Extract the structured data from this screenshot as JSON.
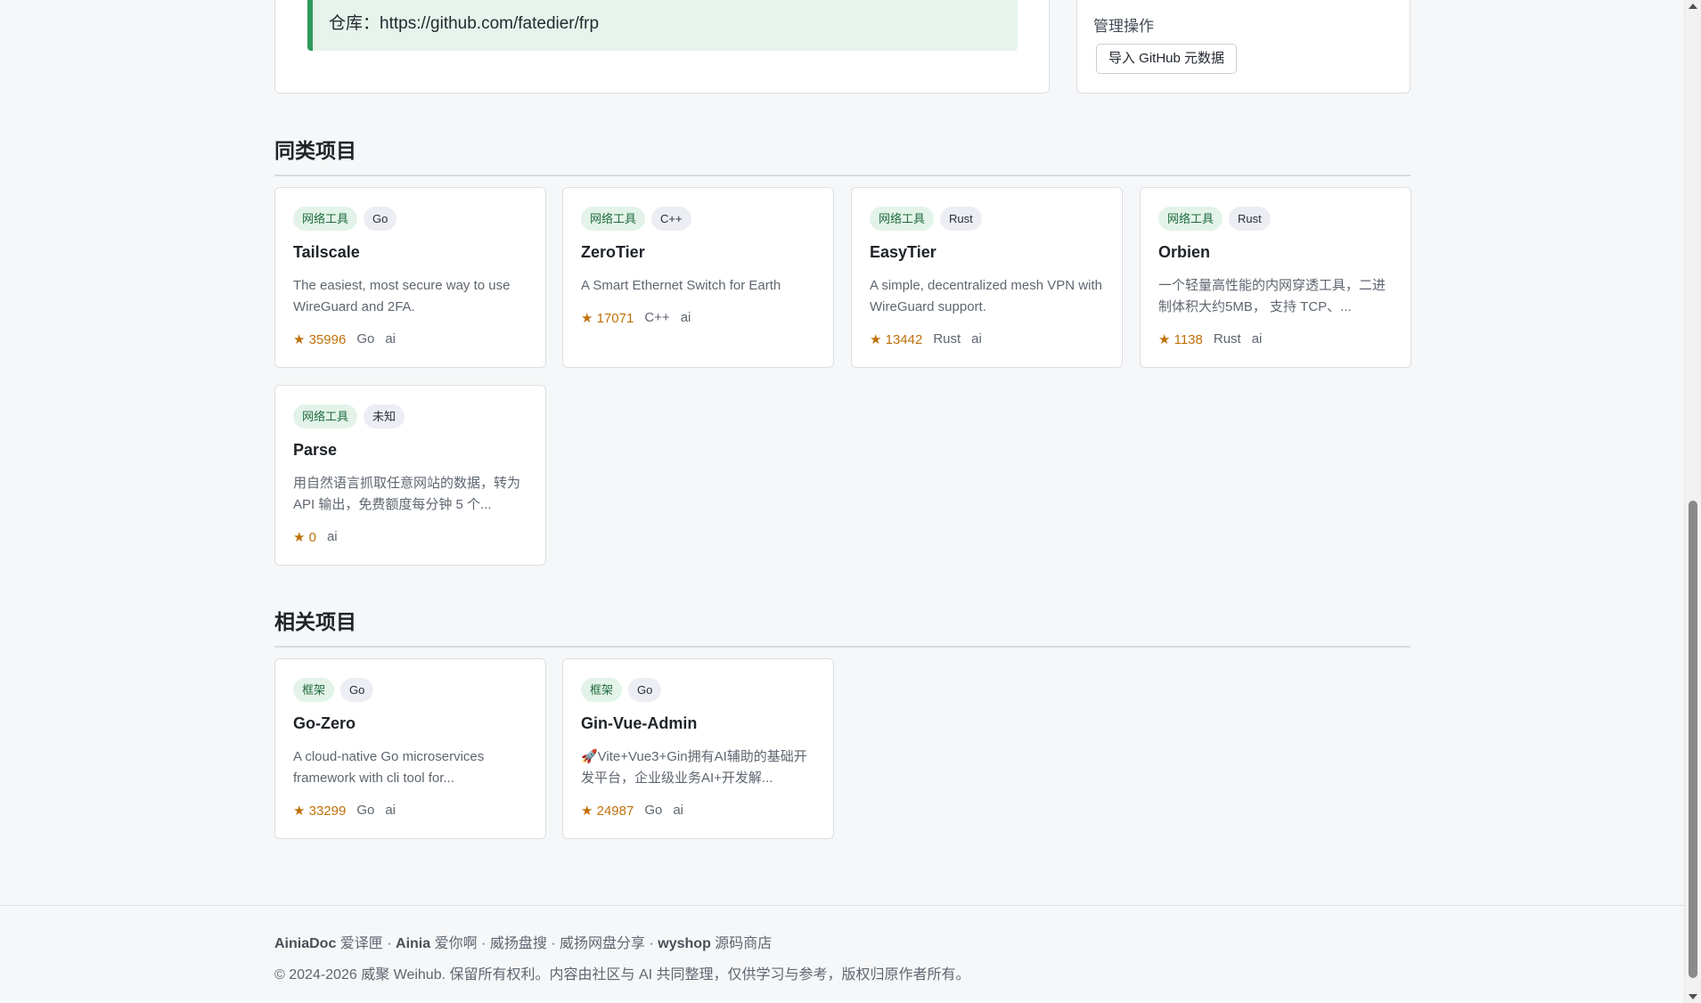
{
  "repo": {
    "text": "仓库：https://github.com/fatedier/frp"
  },
  "admin": {
    "title": "管理操作",
    "import_button": "导入 GitHub 元数据"
  },
  "similar": {
    "title": "同类项目",
    "items": [
      {
        "category": "网络工具",
        "lang_tag": "Go",
        "name": "Tailscale",
        "desc": "The easiest, most secure way to use WireGuard and 2FA.",
        "stars": "★ 35996",
        "lang": "Go",
        "extra": "ai"
      },
      {
        "category": "网络工具",
        "lang_tag": "C++",
        "name": "ZeroTier",
        "desc": "A Smart Ethernet Switch for Earth",
        "stars": "★ 17071",
        "lang": "C++",
        "extra": "ai"
      },
      {
        "category": "网络工具",
        "lang_tag": "Rust",
        "name": "EasyTier",
        "desc": "A simple, decentralized mesh VPN with WireGuard support.",
        "stars": "★ 13442",
        "lang": "Rust",
        "extra": "ai"
      },
      {
        "category": "网络工具",
        "lang_tag": "Rust",
        "name": "Orbien",
        "desc": "一个轻量高性能的内网穿透工具，二进制体积大约5MB， 支持 TCP、...",
        "stars": "★ 1138",
        "lang": "Rust",
        "extra": "ai"
      },
      {
        "category": "网络工具",
        "lang_tag": "未知",
        "name": "Parse",
        "desc": "用自然语言抓取任意网站的数据，转为 API 输出，免费额度每分钟 5 个...",
        "stars": "★ 0",
        "lang": "",
        "extra": "ai"
      }
    ]
  },
  "related": {
    "title": "相关项目",
    "items": [
      {
        "category": "框架",
        "lang_tag": "Go",
        "name": "Go-Zero",
        "desc": "A cloud-native Go microservices framework with cli tool for...",
        "stars": "★ 33299",
        "lang": "Go",
        "extra": "ai"
      },
      {
        "category": "框架",
        "lang_tag": "Go",
        "name": "Gin-Vue-Admin",
        "desc": "🚀Vite+Vue3+Gin拥有AI辅助的基础开发平台，企业级业务AI+开发解...",
        "stars": "★ 24987",
        "lang": "Go",
        "extra": "ai"
      }
    ]
  },
  "footer": {
    "link1_brand": "AiniaDoc",
    "link1_text": " 爱译匣",
    "sep": " · ",
    "link2_brand": "Ainia",
    "link2_text": " 爱你啊",
    "link3": "威扬盘搜",
    "link4": "威扬网盘分享",
    "link5_brand": "wyshop",
    "link5_text": " 源码商店",
    "copyright": "© 2024-2026 威聚 Weihub. 保留所有权利。内容由社区与 AI 共同整理，仅供学习与参考，版权归原作者所有。"
  }
}
